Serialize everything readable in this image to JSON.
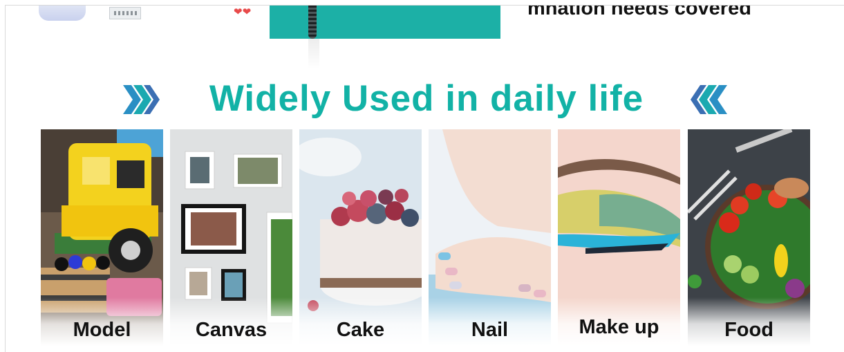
{
  "top_strip": {
    "partial_text": "mnation needs covered",
    "mark": "❤ ❤"
  },
  "section": {
    "title": "Widely Used in daily life",
    "accent_color": "#12b2a6"
  },
  "gallery": {
    "items": [
      {
        "label": "Model",
        "icon": "toy-truck-photo"
      },
      {
        "label": "Canvas",
        "icon": "framed-pictures-photo"
      },
      {
        "label": "Cake",
        "icon": "berry-cake-photo"
      },
      {
        "label": "Nail",
        "icon": "manicured-hand-photo"
      },
      {
        "label": "Make up",
        "icon": "eye-makeup-photo"
      },
      {
        "label": "Food",
        "icon": "salad-bowl-photo"
      }
    ]
  }
}
